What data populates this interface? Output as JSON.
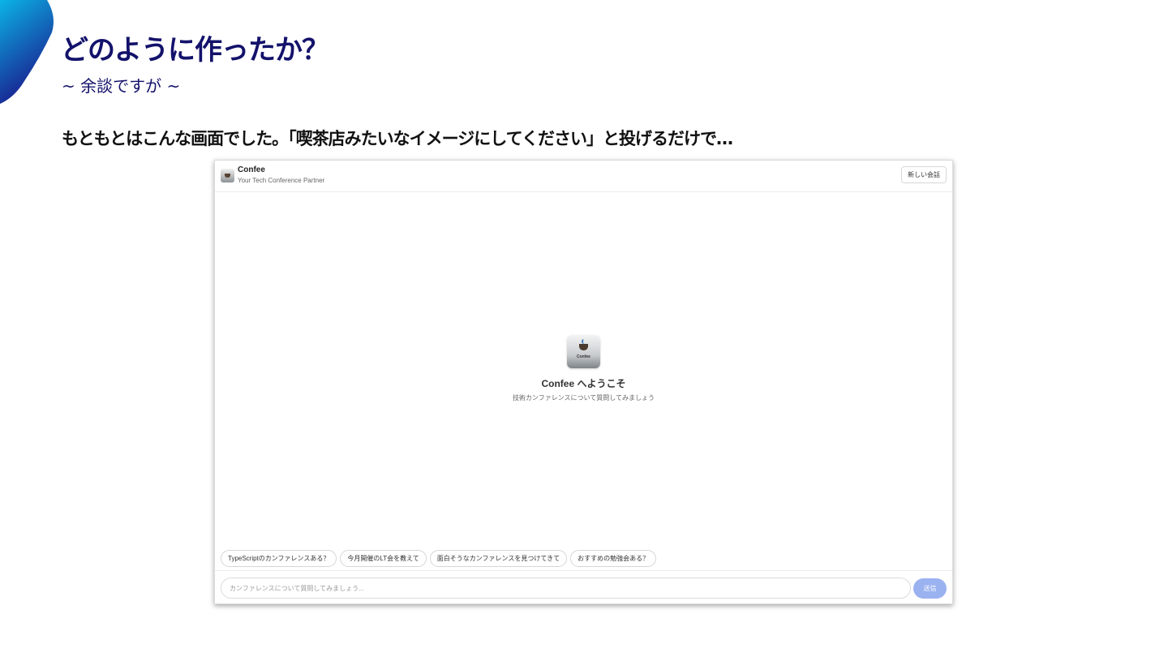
{
  "slide": {
    "title": "どのように作ったか？",
    "subtitle": "~ 余談ですが ~",
    "body": "もともとはこんな画面でした。「喫茶店みたいなイメージにしてください」と投げるだけで…"
  },
  "app": {
    "name": "Confee",
    "tagline": "Your Tech Conference Partner",
    "new_chat_label": "新しい会話",
    "welcome_title": "Confee へようこそ",
    "welcome_subtitle": "技術カンファレンスについて質問してみましょう",
    "logo_text": "Confee",
    "suggestions": [
      "TypeScriptのカンファレンスある？",
      "今月開催のLT会を教えて",
      "面白そうなカンファレンスを見つけてきて",
      "おすすめの勉強会ある？"
    ],
    "input_placeholder": "カンファレンスについて質問してみましょう...",
    "send_label": "送信",
    "accent_color": "#9bb2f1"
  },
  "colors": {
    "title": "#13126b",
    "corner_gradient": [
      "#0bb4e6",
      "#1a1a8c"
    ]
  }
}
